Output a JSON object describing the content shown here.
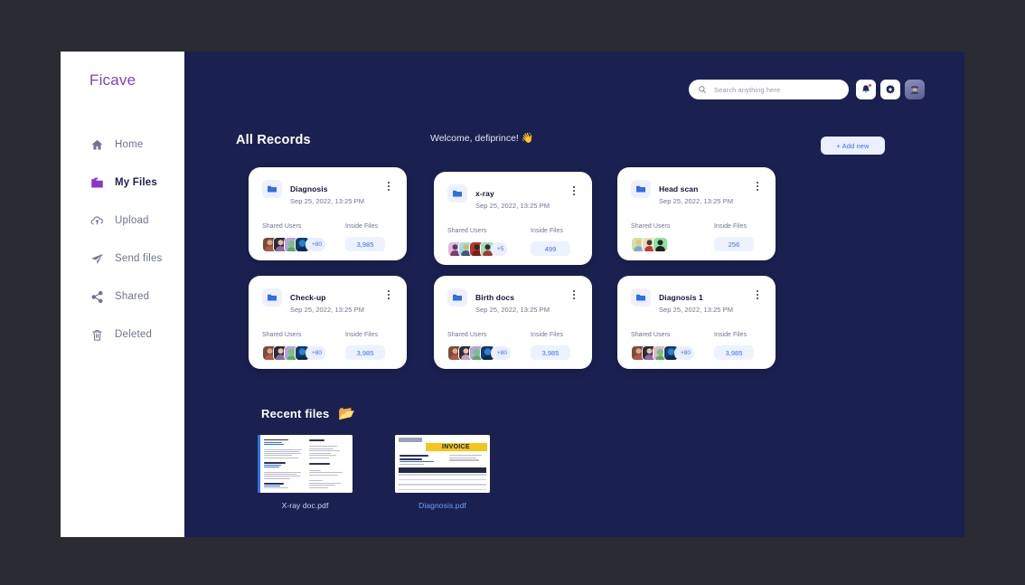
{
  "brand": "Ficave",
  "sidebar": {
    "items": [
      {
        "label": "Home",
        "icon": "home-icon",
        "active": false
      },
      {
        "label": "My Files",
        "icon": "folder-icon",
        "active": true
      },
      {
        "label": "Upload",
        "icon": "upload-icon",
        "active": false
      },
      {
        "label": "Send files",
        "icon": "send-icon",
        "active": false
      },
      {
        "label": "Shared",
        "icon": "share-icon",
        "active": false
      },
      {
        "label": "Deleted",
        "icon": "trash-icon",
        "active": false
      }
    ]
  },
  "header": {
    "welcome": "Welcome, defiprince!",
    "wave_emoji": "👋",
    "search_placeholder": "Search anything here",
    "search_value": "",
    "notification_badge": true,
    "icons": [
      "search-icon",
      "bell-icon",
      "gear-icon",
      "avatar"
    ]
  },
  "main": {
    "section_title": "All Records",
    "add_new_label": "+ Add new",
    "shared_users_label": "Shared Users",
    "inside_files_label": "Inside Files",
    "cards": [
      {
        "title": "Diagnosis",
        "date": "Sep 25, 2022, 13:25 PM",
        "avatars": 4,
        "extra": "+80",
        "files": "3,985"
      },
      {
        "title": "x-ray",
        "date": "Sep 25, 2022, 13:25 PM",
        "avatars": 4,
        "extra": "+5",
        "files": "499"
      },
      {
        "title": "Head scan",
        "date": "Sep 25, 2022, 13:25 PM",
        "avatars": 3,
        "extra": "",
        "files": "256"
      },
      {
        "title": "Check-up",
        "date": "Sep 25, 2022, 13:25 PM",
        "avatars": 4,
        "extra": "+80",
        "files": "3,985"
      },
      {
        "title": "Birth docs",
        "date": "Sep 25, 2022, 13:25 PM",
        "avatars": 4,
        "extra": "+80",
        "files": "3,985"
      },
      {
        "title": "Diagnosis 1",
        "date": "Sep 25, 2022, 13:25 PM",
        "avatars": 4,
        "extra": "+80",
        "files": "3,985"
      }
    ]
  },
  "recent": {
    "title": "Recent files",
    "folder_emoji": "📂",
    "files": [
      {
        "name": "X-ray doc.pdf",
        "kind": "resume"
      },
      {
        "name": "Diagnosis.pdf",
        "kind": "invoice",
        "heading": "INVOICE"
      }
    ]
  },
  "colors": {
    "app_bg": "#1a2150",
    "frame_bg": "#2b2b33",
    "sidebar_bg": "#ffffff",
    "brand": "#7b46b8",
    "accent_blue": "#3d6dfb",
    "card_bg": "#ffffff",
    "muted_text": "#6e7491",
    "badge_red": "#f0454f",
    "invoice_yellow": "#f5c518"
  }
}
